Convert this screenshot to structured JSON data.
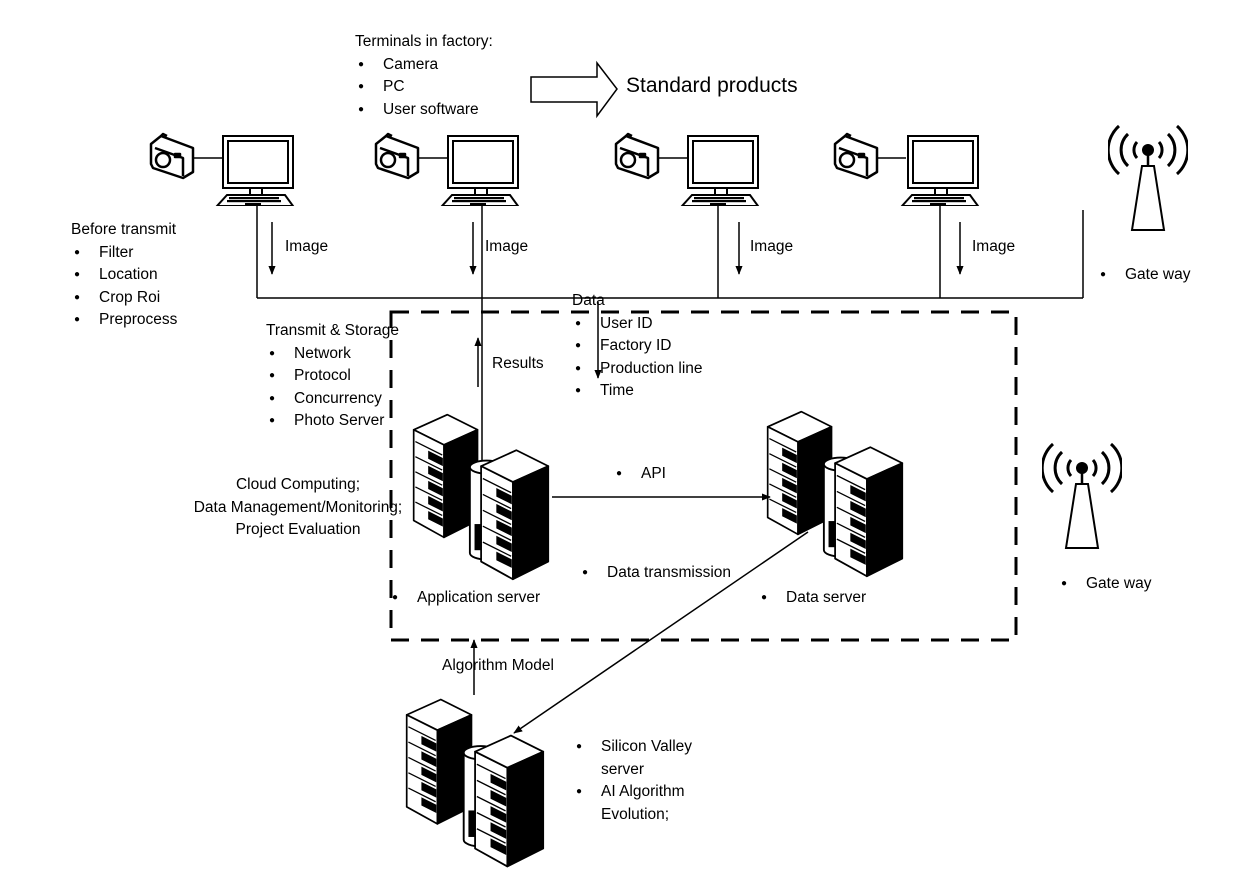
{
  "terminals_block": {
    "heading": "Terminals in factory:",
    "items": [
      "Camera",
      "PC",
      "User software"
    ]
  },
  "standard_products": "Standard products",
  "before_transmit": {
    "heading": "Before transmit",
    "items": [
      "Filter",
      "Location",
      "Crop Roi",
      "Preprocess"
    ]
  },
  "image_arrows": [
    "Image",
    "Image",
    "Image",
    "Image"
  ],
  "gateways": [
    "Gate way",
    "Gate way"
  ],
  "transmit_storage": {
    "heading": "Transmit & Storage",
    "items": [
      "Network",
      "Protocol",
      "Concurrency",
      "Photo Server"
    ]
  },
  "results_label": "Results",
  "data_block": {
    "heading": "Data",
    "items": [
      "User ID",
      "Factory ID",
      "Production line",
      "Time"
    ]
  },
  "cloud_label": {
    "line1": "Cloud Computing;",
    "line2": "Data Management/Monitoring;",
    "line3": "Project Evaluation"
  },
  "api_label": "API",
  "data_transmission_label": "Data transmission",
  "application_server_label": "Application server",
  "data_server_label": "Data server",
  "algorithm_model_label": "Algorithm Model",
  "silicon_valley_block": {
    "items": [
      "Silicon Valley server",
      "AI Algorithm Evolution;"
    ],
    "item1_line1": "Silicon Valley",
    "item1_line2": "server",
    "item2_line1": "AI Algorithm",
    "item2_line2": "Evolution;"
  },
  "colors": {
    "ink": "#000000",
    "background": "#ffffff"
  }
}
